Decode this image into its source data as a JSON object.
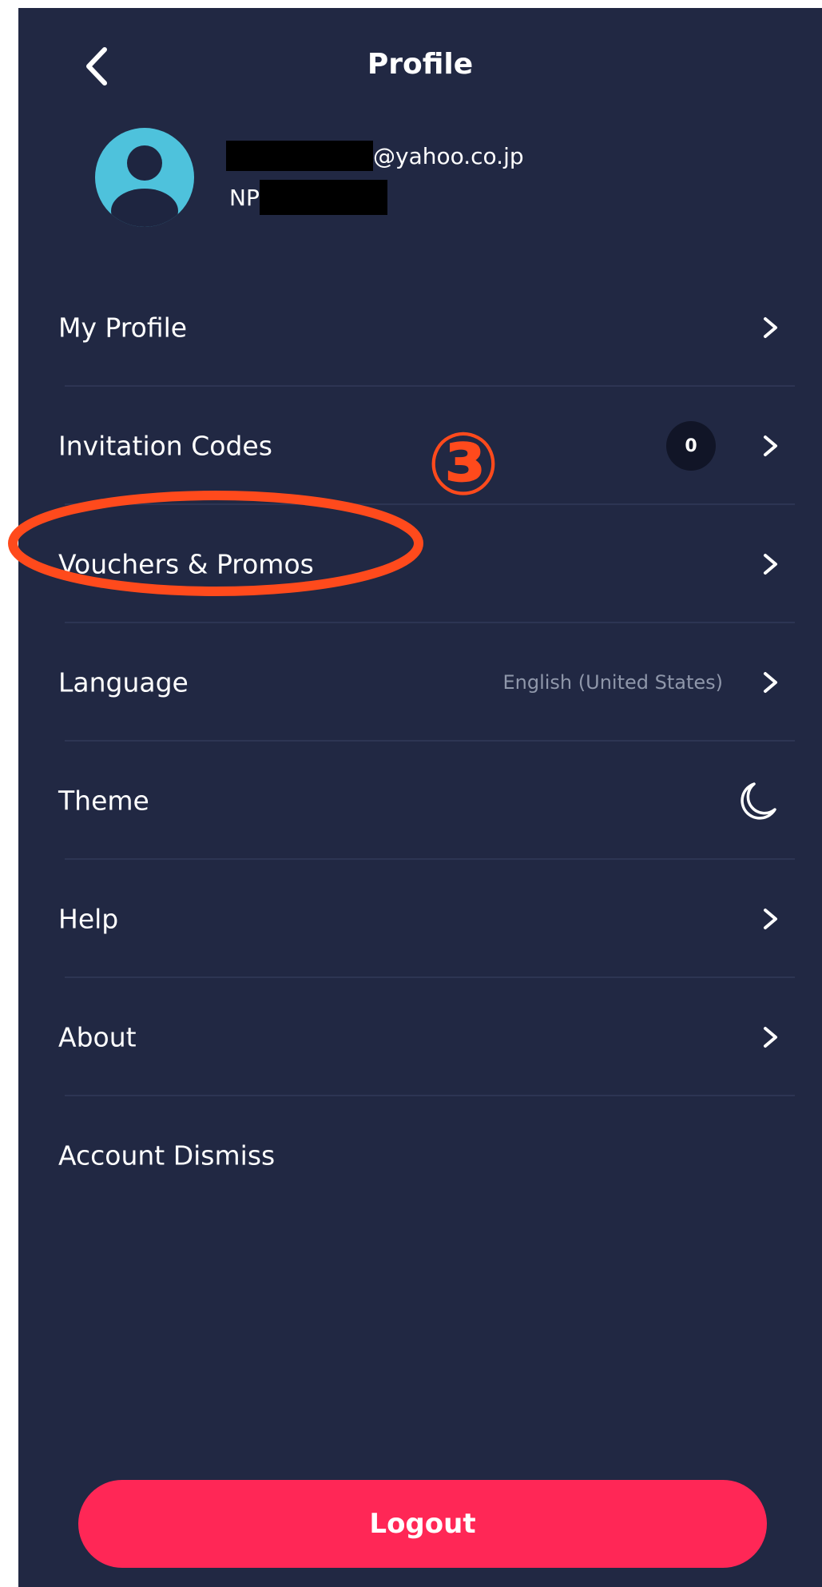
{
  "header": {
    "title": "Profile",
    "back_icon": "chevron-left-icon"
  },
  "user": {
    "avatar_icon": "user-avatar-icon",
    "email_suffix": "@yahoo.co.jp",
    "id_prefix": "NP"
  },
  "menu": {
    "items": [
      {
        "label": "My Profile"
      },
      {
        "label": "Invitation Codes",
        "badge": "0"
      },
      {
        "label": "Vouchers & Promos"
      },
      {
        "label": "Language",
        "value": "English (United States)"
      },
      {
        "label": "Theme",
        "icon": "moon-icon"
      },
      {
        "label": "Help"
      },
      {
        "label": "About"
      },
      {
        "label": "Account Dismiss"
      }
    ]
  },
  "annotation": {
    "step_number": "③",
    "color": "#ff4a1c"
  },
  "logout": {
    "label": "Logout"
  },
  "colors": {
    "background": "#212843",
    "accent": "#ff2756",
    "avatar": "#4ec2dc",
    "muted_text": "#8f97aa"
  }
}
